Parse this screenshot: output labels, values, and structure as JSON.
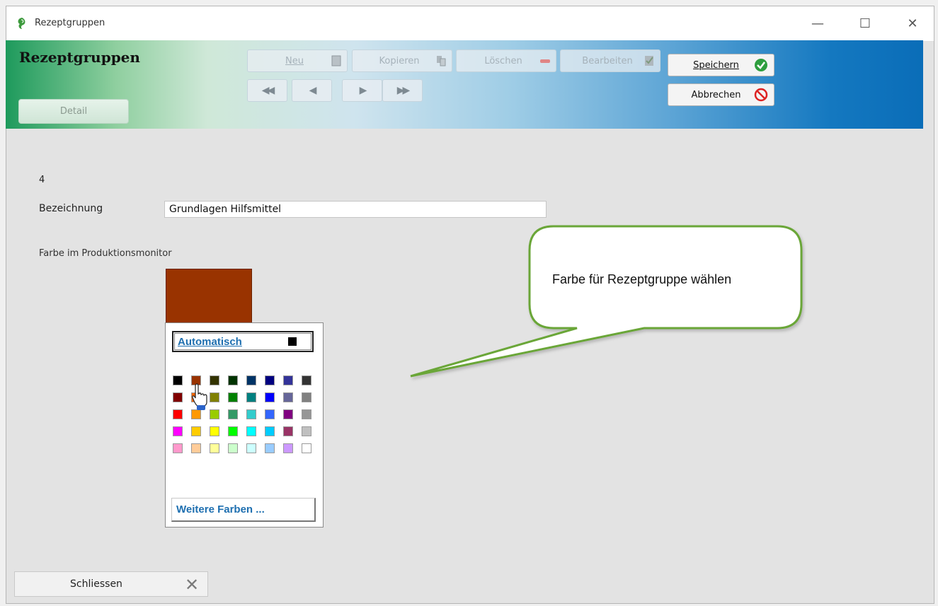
{
  "window": {
    "title": "Rezeptgruppen",
    "controls": {
      "minimize": "—",
      "maximize": "☐",
      "close": "✕"
    }
  },
  "banner": {
    "title": "Rezeptgruppen",
    "tab_detail": "Detail",
    "buttons": {
      "neu": "Neu",
      "kopieren": "Kopieren",
      "loeschen": "Löschen",
      "bearbeiten": "Bearbeiten",
      "speichern": "Speichern",
      "abbrechen": "Abbrechen"
    },
    "nav": {
      "first": "◀◀",
      "prev": "◀",
      "next": "▶",
      "last": "▶▶"
    }
  },
  "form": {
    "record_number": "4",
    "bezeichnung_label": "Bezeichnung",
    "bezeichnung_value": "Grundlagen Hilfsmittel",
    "farbe_label": "Farbe im Produktionsmonitor",
    "selected_color": "#993300"
  },
  "palette": {
    "auto_label": "Automatisch",
    "more_label": "Weitere Farben ...",
    "rows": [
      [
        "#000000",
        "#993300",
        "#333300",
        "#003300",
        "#003366",
        "#000080",
        "#333399",
        "#333333"
      ],
      [
        "#800000",
        "#ff6600",
        "#808000",
        "#008000",
        "#008080",
        "#0000ff",
        "#666699",
        "#808080"
      ],
      [
        "#ff0000",
        "#ff9900",
        "#99cc00",
        "#339966",
        "#33cccc",
        "#3366ff",
        "#800080",
        "#969696"
      ],
      [
        "#ff00ff",
        "#ffcc00",
        "#ffff00",
        "#00ff00",
        "#00ffff",
        "#00ccff",
        "#993366",
        "#c0c0c0"
      ],
      [
        "#ff99cc",
        "#ffcc99",
        "#ffff99",
        "#ccffcc",
        "#ccffff",
        "#99ccff",
        "#cc99ff",
        "#ffffff"
      ]
    ]
  },
  "callout": {
    "text": "Farbe für Rezeptgruppe wählen"
  },
  "footer": {
    "close_label": "Schliessen",
    "close_icon": "✕"
  }
}
